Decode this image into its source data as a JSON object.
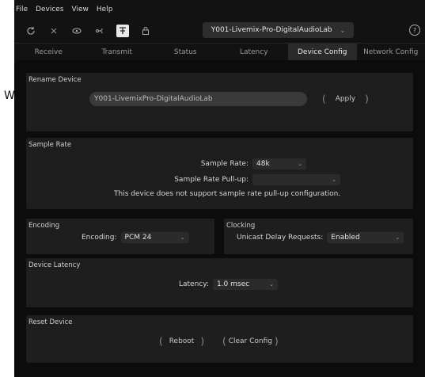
{
  "stray_text": "W.",
  "menu": [
    "File",
    "Devices",
    "View",
    "Help"
  ],
  "toolbar": {
    "icons": [
      "refresh-icon",
      "close-icon",
      "eye-icon",
      "network-icon",
      "identify-icon",
      "lock-icon"
    ],
    "device_select": "Y001-Livemix-Pro-DigitalAudioLab",
    "help": "?"
  },
  "tabs": [
    "Receive",
    "Transmit",
    "Status",
    "Latency",
    "Device Config",
    "Network Config"
  ],
  "rename": {
    "title": "Rename Device",
    "value": "Y001-LivemixPro-DigitalAudioLab",
    "apply": "Apply"
  },
  "sample_rate": {
    "title": "Sample Rate",
    "rate_label": "Sample Rate:",
    "rate_value": "48k",
    "pullup_label": "Sample Rate Pull-up:",
    "pullup_value": "",
    "note": "This device does not support sample rate pull-up configuration."
  },
  "encoding": {
    "title": "Encoding",
    "label": "Encoding:",
    "value": "PCM 24"
  },
  "clocking": {
    "title": "Clocking",
    "label": "Unicast Delay Requests:",
    "value": "Enabled"
  },
  "device_latency": {
    "title": "Device Latency",
    "label": "Latency:",
    "value": "1.0 msec"
  },
  "reset": {
    "title": "Reset Device",
    "reboot": "Reboot",
    "clear": "Clear Config"
  }
}
